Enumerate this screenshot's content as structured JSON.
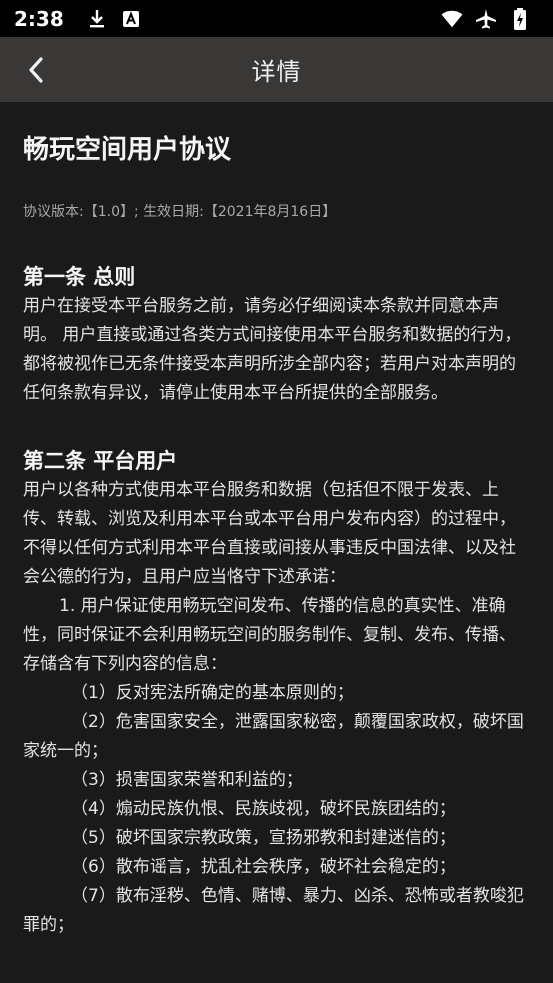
{
  "status": {
    "time": "2:38"
  },
  "header": {
    "title": "详情"
  },
  "doc": {
    "title": "畅玩空间用户协议",
    "version": "协议版本:【1.0】; 生效日期:【2021年8月16日】",
    "s1": {
      "title": "第一条 总则",
      "body": "用户在接受本平台服务之前，请务必仔细阅读本条款并同意本声明。 用户直接或通过各类方式间接使用本平台服务和数据的行为，都将被视作已无条件接受本声明所涉全部内容；若用户对本声明的任何条款有异议，请停止使用本平台所提供的全部服务。"
    },
    "s2": {
      "title": "第二条 平台用户",
      "body": "用户以各种方式使用本平台服务和数据（包括但不限于发表、上传、转载、浏览及利用本平台或本平台用户发布内容）的过程中，不得以任何方式利用本平台直接或间接从事违反中国法律、以及社会公德的行为，且用户应当恪守下述承诺：",
      "item1": "1. 用户保证使用畅玩空间发布、传播的信息的真实性、准确性，同时保证不会利用畅玩空间的服务制作、复制、发布、传播、存储含有下列内容的信息：",
      "sub": [
        "（1）反对宪法所确定的基本原则的；",
        "（2）危害国家安全，泄露国家秘密，颠覆国家政权，破坏国家统一的；",
        "（3）损害国家荣誉和利益的；",
        "（4）煽动民族仇恨、民族歧视，破坏民族团结的；",
        "（5）破坏国家宗教政策，宣扬邪教和封建迷信的；",
        "（6）散布谣言，扰乱社会秩序，破坏社会稳定的；",
        "（7）散布淫秽、色情、赌博、暴力、凶杀、恐怖或者教唆犯罪的；"
      ]
    }
  }
}
